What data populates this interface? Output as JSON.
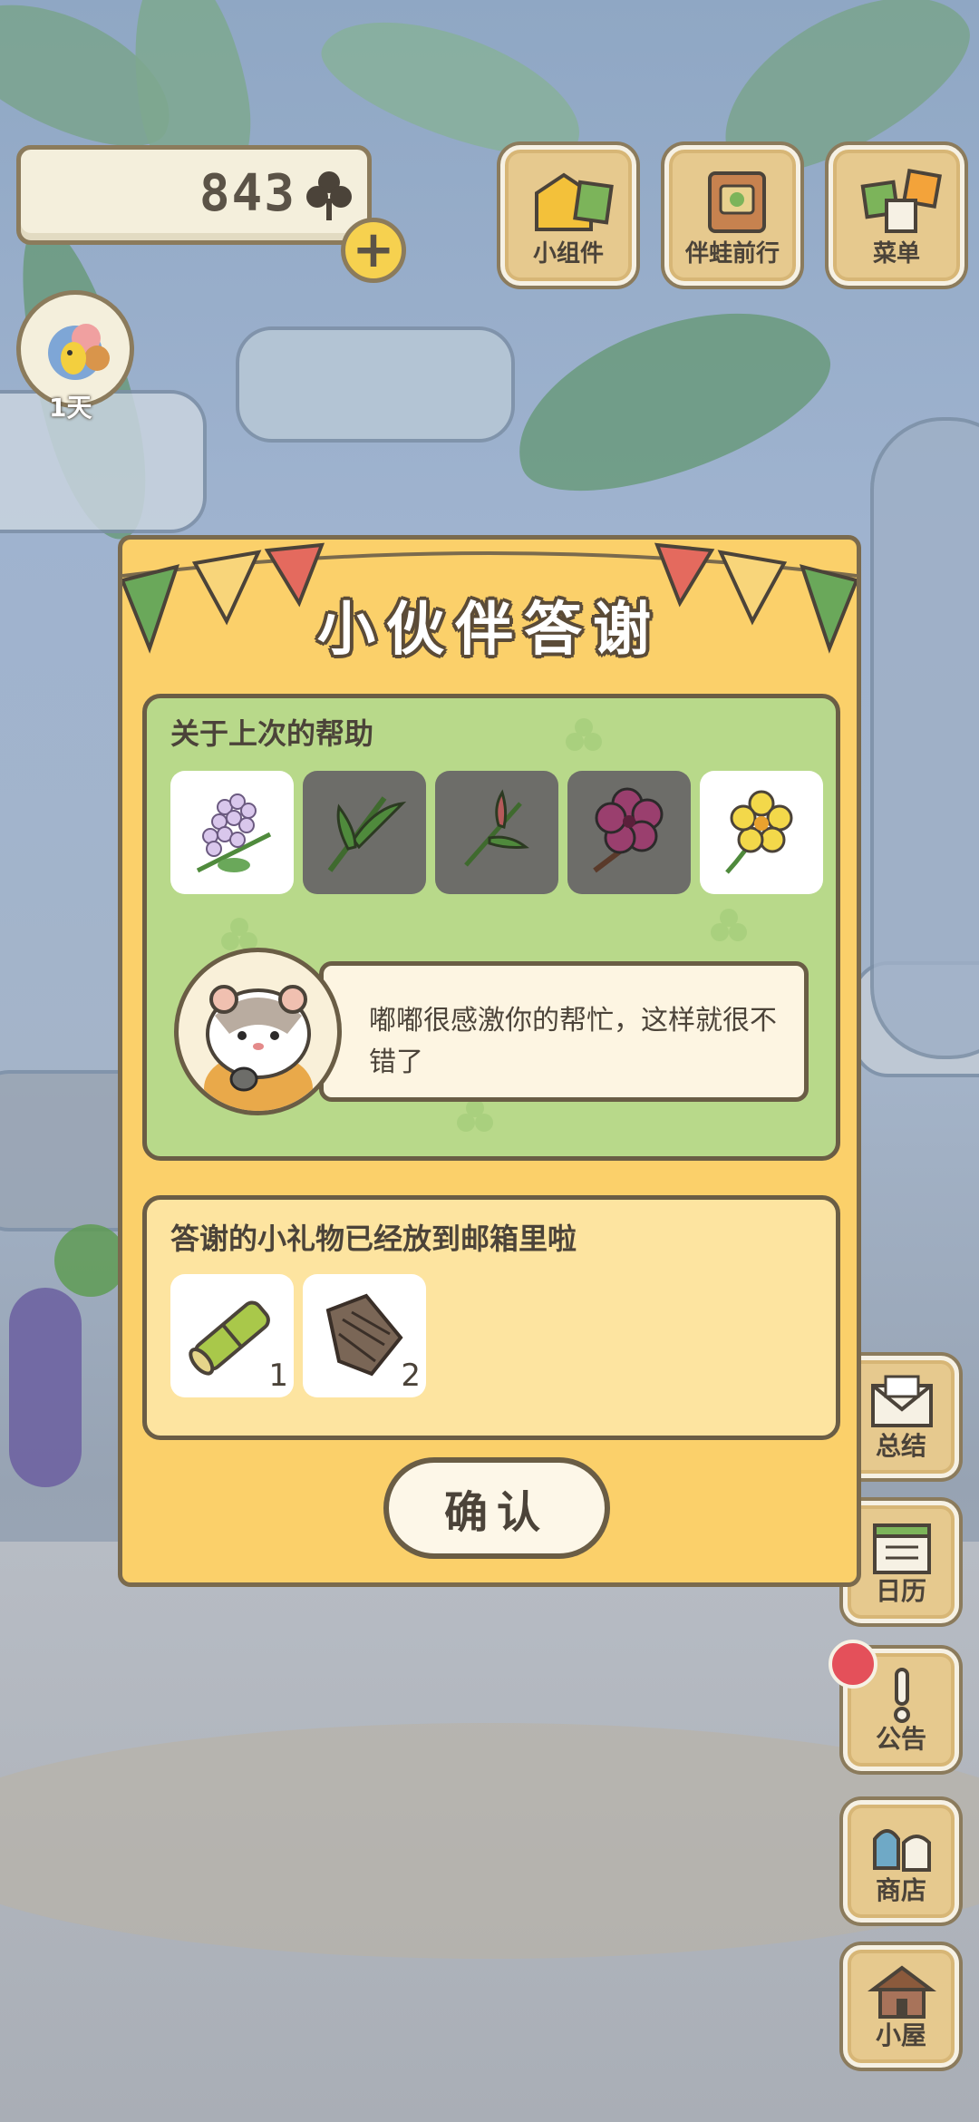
{
  "hud": {
    "clover_count": "843",
    "day_label": "1天"
  },
  "top_menu": [
    {
      "label": "小组件",
      "icon": "widget-icon"
    },
    {
      "label": "伴蛙前行",
      "icon": "journal-icon"
    },
    {
      "label": "菜单",
      "icon": "menu-cards-icon"
    }
  ],
  "side_menu": [
    {
      "label": "总结",
      "icon": "envelope-icon"
    },
    {
      "label": "日历",
      "icon": "calendar-icon"
    },
    {
      "label": "公告",
      "icon": "exclamation-icon"
    },
    {
      "label": "商店",
      "icon": "bags-icon"
    },
    {
      "label": "小屋",
      "icon": "house-icon"
    }
  ],
  "dialog": {
    "title": "小伙伴答谢",
    "help_section": {
      "heading": "关于上次的帮助",
      "items": [
        {
          "icon": "lilac-flower-icon",
          "state": "collected"
        },
        {
          "icon": "grass-stem-icon",
          "state": "missing"
        },
        {
          "icon": "sprig-icon",
          "state": "missing"
        },
        {
          "icon": "hibiscus-icon",
          "state": "missing"
        },
        {
          "icon": "yellow-flower-icon",
          "state": "collected"
        }
      ],
      "message": "嘟嘟很感激你的帮忙，这样就很不错了",
      "speaker_icon": "hamster-icon"
    },
    "gift_section": {
      "heading": "答谢的小礼物已经放到邮箱里啦",
      "gifts": [
        {
          "icon": "bamboo-icon",
          "quantity": "1"
        },
        {
          "icon": "wood-bark-icon",
          "quantity": "2"
        }
      ]
    },
    "confirm_label": "确认"
  },
  "colors": {
    "dialog_bg": "#fbd06a",
    "help_panel_bg": "#b8d98a",
    "gift_panel_bg": "#fde4a0",
    "button_wood": "#e6c98e",
    "notification_dot": "#e4505a"
  }
}
